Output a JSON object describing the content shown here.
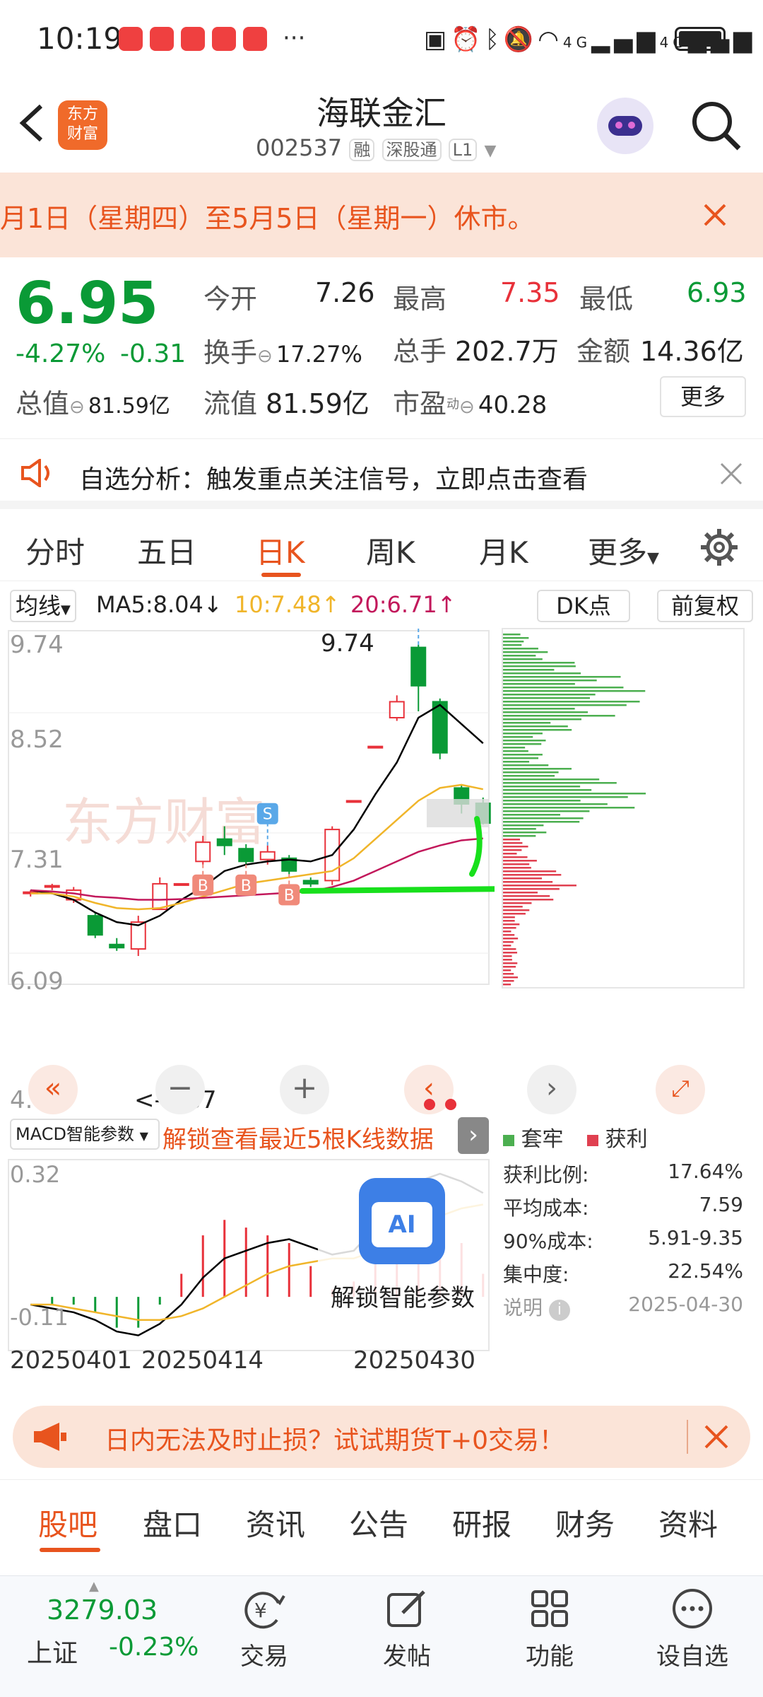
{
  "status": {
    "time": "10:19",
    "more": "···",
    "net1": "4G",
    "net2": "4G"
  },
  "header": {
    "title": "海联金汇",
    "code": "002537",
    "tags": [
      "融",
      "深股通",
      "L1"
    ],
    "logo_line1": "东方",
    "logo_line2": "财富"
  },
  "notice": {
    "text": "月1日（星期四）至5月5日（星期一）休市。"
  },
  "quote": {
    "price": "6.95",
    "change_pct": "-4.27%",
    "change": "-0.31",
    "open_label": "今开",
    "open": "7.26",
    "high_label": "最高",
    "high": "7.35",
    "low_label": "最低",
    "low": "6.93",
    "turnover_label": "换手",
    "turnover": "17.27%",
    "volume_label": "总手",
    "volume": "202.7万",
    "amount_label": "金额",
    "amount": "14.36亿",
    "mktcap_label": "总值",
    "mktcap": "81.59亿",
    "float_label": "流值",
    "float": "81.59亿",
    "pe_label": "市盈",
    "pe_sup": "动",
    "pe": "40.28",
    "more_button": "更多"
  },
  "alert": {
    "text": "自选分析：触发重点关注信号，立即点击查看"
  },
  "tabs": [
    "分时",
    "五日",
    "日K",
    "周K",
    "月K",
    "更多"
  ],
  "chart_toolbar": {
    "ma_select": "均线",
    "ma5": "MA5:8.04↓",
    "ma10": "10:7.48↑",
    "ma20": "20:6.71↑",
    "dk_button": "DK点",
    "adjust_button": "前复权"
  },
  "colors": {
    "up": "#e8313a",
    "down": "#0a9a36",
    "accent": "#e8541e",
    "ma5": "#000000",
    "ma10": "#f0b52a",
    "ma20": "#c2185b",
    "annotation": "#18e01c"
  },
  "kline_axis": {
    "y_ticks": [
      "9.74",
      "8.52",
      "7.31",
      "6.09",
      "4.87"
    ],
    "high_label": "9.74",
    "low_label": "<-4.87"
  },
  "chart_data": {
    "type": "candlestick",
    "ylim": [
      4.87,
      9.74
    ],
    "candles": [
      {
        "o": 5.85,
        "c": 5.87,
        "h": 5.9,
        "l": 5.8
      },
      {
        "o": 5.95,
        "c": 5.97,
        "h": 6.0,
        "l": 5.9
      },
      {
        "o": 5.75,
        "c": 5.9,
        "h": 5.95,
        "l": 5.7
      },
      {
        "o": 5.5,
        "c": 5.2,
        "h": 5.55,
        "l": 5.15
      },
      {
        "o": 5.05,
        "c": 5.0,
        "h": 5.15,
        "l": 4.95
      },
      {
        "o": 4.98,
        "c": 5.4,
        "h": 5.5,
        "l": 4.87
      },
      {
        "o": 5.6,
        "c": 6.0,
        "h": 6.1,
        "l": 5.6
      },
      {
        "o": 6.0,
        "c": 6.0,
        "h": 6.0,
        "l": 6.0
      },
      {
        "o": 6.35,
        "c": 6.65,
        "h": 6.75,
        "l": 6.3
      },
      {
        "o": 6.7,
        "c": 6.6,
        "h": 6.9,
        "l": 6.45
      },
      {
        "o": 6.55,
        "c": 6.35,
        "h": 6.62,
        "l": 6.3
      },
      {
        "o": 6.38,
        "c": 6.5,
        "h": 6.6,
        "l": 6.3
      },
      {
        "o": 6.4,
        "c": 6.2,
        "h": 6.45,
        "l": 6.15
      },
      {
        "o": 6.05,
        "c": 6.0,
        "h": 6.1,
        "l": 5.95
      },
      {
        "o": 6.05,
        "c": 6.85,
        "h": 6.9,
        "l": 5.98
      },
      {
        "o": 7.3,
        "c": 7.3,
        "h": 7.3,
        "l": 7.3
      },
      {
        "o": 8.15,
        "c": 8.15,
        "h": 8.15,
        "l": 8.15
      },
      {
        "o": 8.6,
        "c": 8.85,
        "h": 8.95,
        "l": 8.55
      },
      {
        "o": 9.7,
        "c": 9.1,
        "h": 9.74,
        "l": 8.7
      },
      {
        "o": 8.85,
        "c": 8.05,
        "h": 8.9,
        "l": 7.95
      },
      {
        "o": 7.5,
        "c": 7.25,
        "h": 7.55,
        "l": 7.1
      },
      {
        "o": 7.26,
        "c": 6.95,
        "h": 7.35,
        "l": 6.93
      }
    ],
    "ma5": [
      5.9,
      5.85,
      5.75,
      5.55,
      5.4,
      5.35,
      5.5,
      5.75,
      5.95,
      6.2,
      6.3,
      6.35,
      6.38,
      6.35,
      6.45,
      6.85,
      7.4,
      7.9,
      8.6,
      8.8,
      8.5,
      8.2
    ],
    "ma10": [
      5.85,
      5.85,
      5.8,
      5.7,
      5.62,
      5.6,
      5.62,
      5.7,
      5.8,
      5.9,
      6.0,
      6.05,
      6.1,
      6.15,
      6.2,
      6.4,
      6.7,
      7.0,
      7.3,
      7.5,
      7.55,
      7.48
    ],
    "ma20": [
      5.9,
      5.88,
      5.85,
      5.8,
      5.78,
      5.75,
      5.75,
      5.76,
      5.78,
      5.8,
      5.82,
      5.84,
      5.86,
      5.88,
      5.95,
      6.05,
      6.2,
      6.35,
      6.5,
      6.6,
      6.68,
      6.71
    ],
    "signals": [
      {
        "i": 8,
        "label": "B"
      },
      {
        "i": 10,
        "label": "B"
      },
      {
        "i": 12,
        "label": "B"
      },
      {
        "i": 11,
        "label": "S"
      },
      {
        "i": 18,
        "label": "S"
      }
    ],
    "macd_ylim": [
      -0.11,
      0.32
    ],
    "macd_dif": [
      -0.02,
      -0.03,
      -0.04,
      -0.06,
      -0.09,
      -0.1,
      -0.07,
      -0.02,
      0.05,
      0.1,
      0.12,
      0.14,
      0.15,
      0.13,
      0.11,
      0.12,
      0.18,
      0.25,
      0.3,
      0.32,
      0.3,
      0.27
    ],
    "macd_dea": [
      -0.02,
      -0.02,
      -0.03,
      -0.04,
      -0.05,
      -0.06,
      -0.06,
      -0.05,
      -0.03,
      0.0,
      0.03,
      0.06,
      0.08,
      0.09,
      0.1,
      0.1,
      0.12,
      0.15,
      0.18,
      0.21,
      0.23,
      0.24
    ],
    "macd_hist": [
      0.0,
      -0.02,
      -0.02,
      -0.04,
      -0.08,
      -0.08,
      -0.02,
      0.06,
      0.16,
      0.2,
      0.18,
      0.16,
      0.14,
      0.08,
      0.02,
      0.04,
      0.12,
      0.2,
      0.24,
      0.22,
      0.14,
      0.06
    ],
    "dates": [
      "20250401",
      "20250414",
      "20250430"
    ]
  },
  "chips": {
    "legend_hold": "套牢",
    "legend_profit": "获利",
    "stats": [
      {
        "label": "获利比例:",
        "value": "17.64%"
      },
      {
        "label": "平均成本:",
        "value": "7.59"
      },
      {
        "label": "90%成本:",
        "value": "5.91-9.35"
      },
      {
        "label": "集中度:",
        "value": "22.54%"
      }
    ],
    "note_label": "说明",
    "date": "2025-04-30"
  },
  "macd": {
    "select": "MACD智能参数",
    "unlock5": "解锁查看最近5根K线数据",
    "ai_label": "AI",
    "unlock_ai": "解锁智能参数",
    "y_top": "0.32",
    "y_bottom": "-0.11"
  },
  "futures_banner": {
    "text": "日内无法及时止损？试试期货T+0交易！"
  },
  "subtabs": [
    "股吧",
    "盘口",
    "资讯",
    "公告",
    "研报",
    "财务",
    "资料"
  ],
  "bottom": {
    "index_value": "3279.03",
    "index_name": "上证",
    "index_change": "-0.23%",
    "trade": "交易",
    "post": "发帖",
    "function": "功能",
    "watchlist": "设自选"
  }
}
